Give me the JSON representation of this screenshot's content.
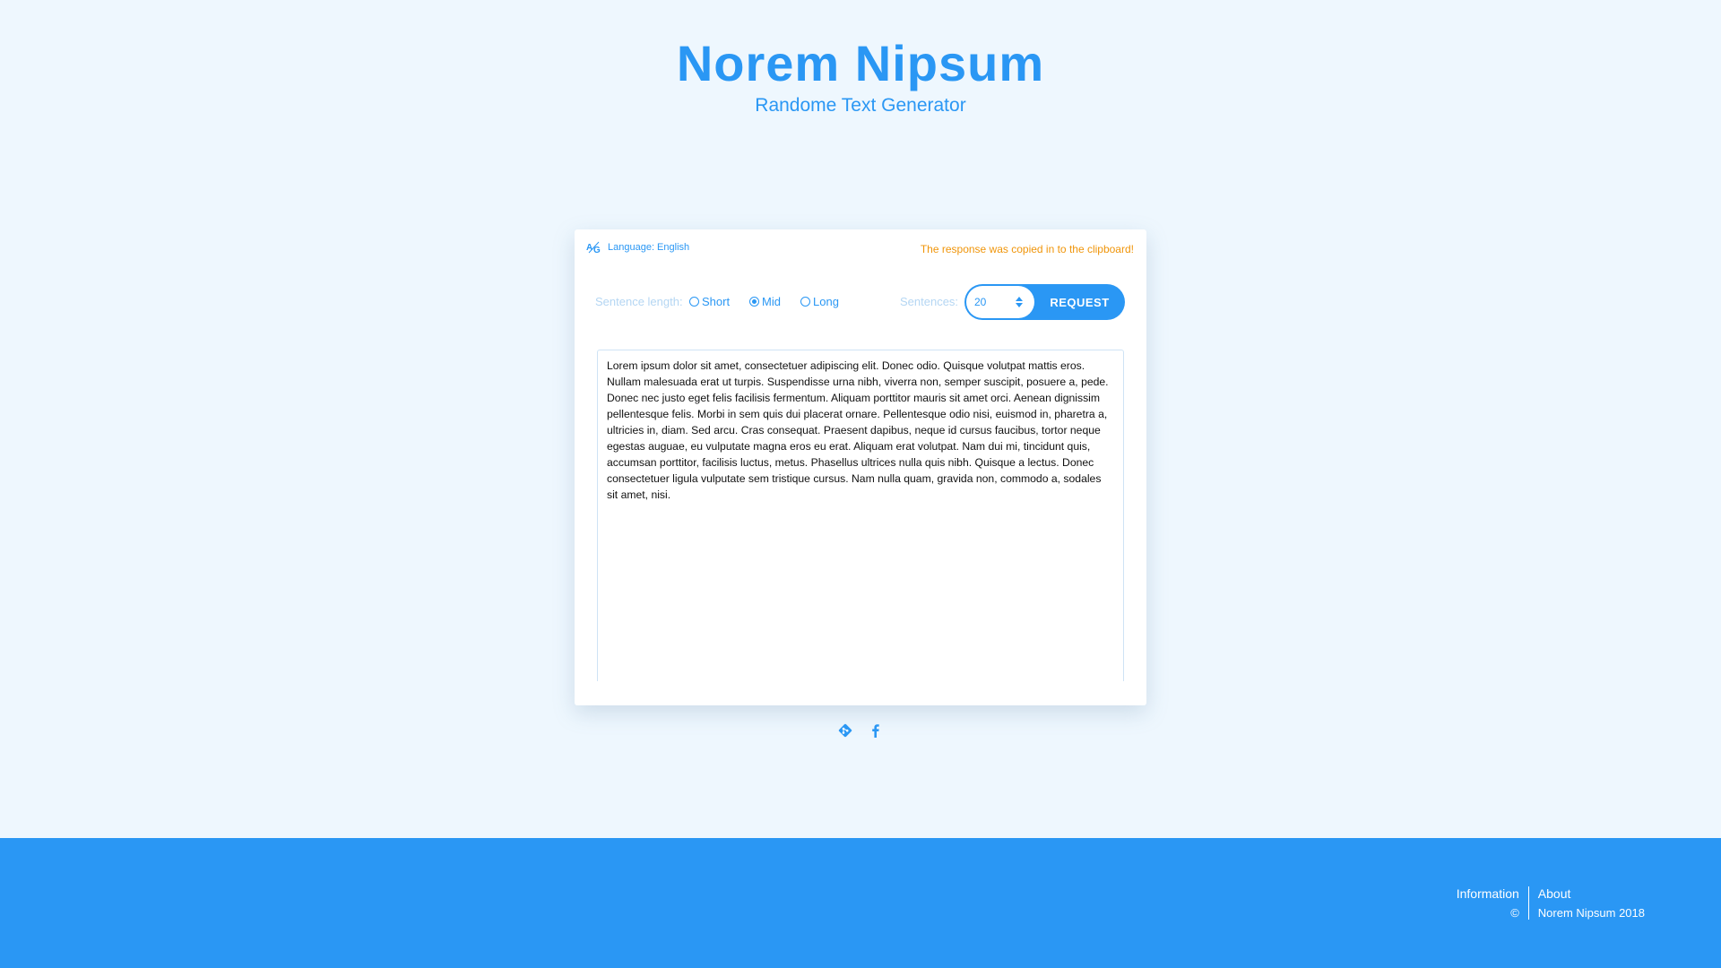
{
  "header": {
    "title": "Norem Nipsum",
    "subtitle": "Randome Text Generator"
  },
  "toolbar": {
    "language_label": "Language: English",
    "copied_notice": "The response was copied in to the clipboard!",
    "sentence_length_label": "Sentence length:",
    "length_options": [
      {
        "label": "Short",
        "checked": false
      },
      {
        "label": "Mid",
        "checked": true
      },
      {
        "label": "Long",
        "checked": false
      }
    ],
    "sentences_label": "Sentences:",
    "sentences_value": "20",
    "request_label": "REQUEST"
  },
  "output": {
    "text": "Lorem ipsum dolor sit amet, consectetuer adipiscing elit. Donec odio. Quisque volutpat mattis eros. Nullam malesuada erat ut turpis. Suspendisse urna nibh, viverra non, semper suscipit, posuere a, pede. Donec nec justo eget felis facilisis fermentum. Aliquam porttitor mauris sit amet orci. Aenean dignissim pellentesque felis. Morbi in sem quis dui placerat ornare. Pellentesque odio nisi, euismod in, pharetra a, ultricies in, diam. Sed arcu. Cras consequat. Praesent dapibus, neque id cursus faucibus, tortor neque egestas auguae, eu vulputate magna eros eu erat. Aliquam erat volutpat. Nam dui mi, tincidunt quis, accumsan porttitor, facilisis luctus, metus. Phasellus ultrices nulla quis nibh. Quisque a lectus. Donec consectetuer ligula vulputate sem tristique cursus. Nam nulla quam, gravida non, commodo a, sodales sit amet, nisi."
  },
  "socials": {
    "icons": [
      "git-icon",
      "facebook-icon"
    ]
  },
  "footer": {
    "information_label": "Information",
    "copyright_symbol": "©",
    "about_label": "About",
    "copyright_text": "Norem Nipsum 2018"
  },
  "colors": {
    "accent": "#2a97f4",
    "background": "#eef7fe",
    "notice": "#f0950a",
    "muted_label": "#b4d6f3"
  }
}
